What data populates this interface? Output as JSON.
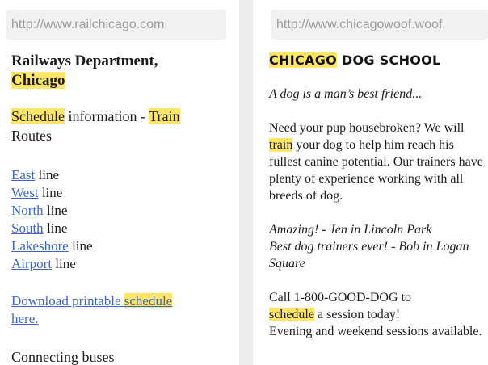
{
  "left": {
    "url": "http://www.railchicago.com",
    "title_line1": "Railways Department,",
    "title_line2": "Chicago",
    "schedule_word": "Schedule",
    "schedule_mid": " information - ",
    "train_word": "Train",
    "routes": "Routes",
    "lines": [
      {
        "link": "East",
        "suffix": " line"
      },
      {
        "link": "West",
        "suffix": " line"
      },
      {
        "link": "North",
        "suffix": " line"
      },
      {
        "link": "South",
        "suffix": " line"
      },
      {
        "link": "Lakeshore",
        "suffix": " line"
      },
      {
        "link": "Airport",
        "suffix": " line"
      }
    ],
    "download_prefix": "Download printable ",
    "download_schedule": "schedule",
    "download_suffix": "here.",
    "connecting": "Connecting buses"
  },
  "right": {
    "url": "http://www.chicagowoof.woof",
    "brand_hl": "CHICAGO",
    "brand_rest": " DOG SCHOOL",
    "tagline": "A dog is a man’s best friend...",
    "para1_a": "Need your pup housebroken? We will ",
    "para1_train": "train",
    "para1_b": " your dog to help him reach his fullest canine potential. Our trainers have plenty of experience working with all breeds of dog.",
    "review1": "Amazing! - Jen in Lincoln Park",
    "review2": "Best dog trainers ever! - Bob in Logan Square",
    "call_a": "Call 1-800-GOOD-DOG to",
    "call_schedule": "schedule",
    "call_b": " a session today!",
    "call_c": "Evening and weekend sessions available."
  },
  "colors": {
    "highlight": "#fde56a",
    "link": "#3b66c8",
    "url_text": "#9b9b9b"
  }
}
